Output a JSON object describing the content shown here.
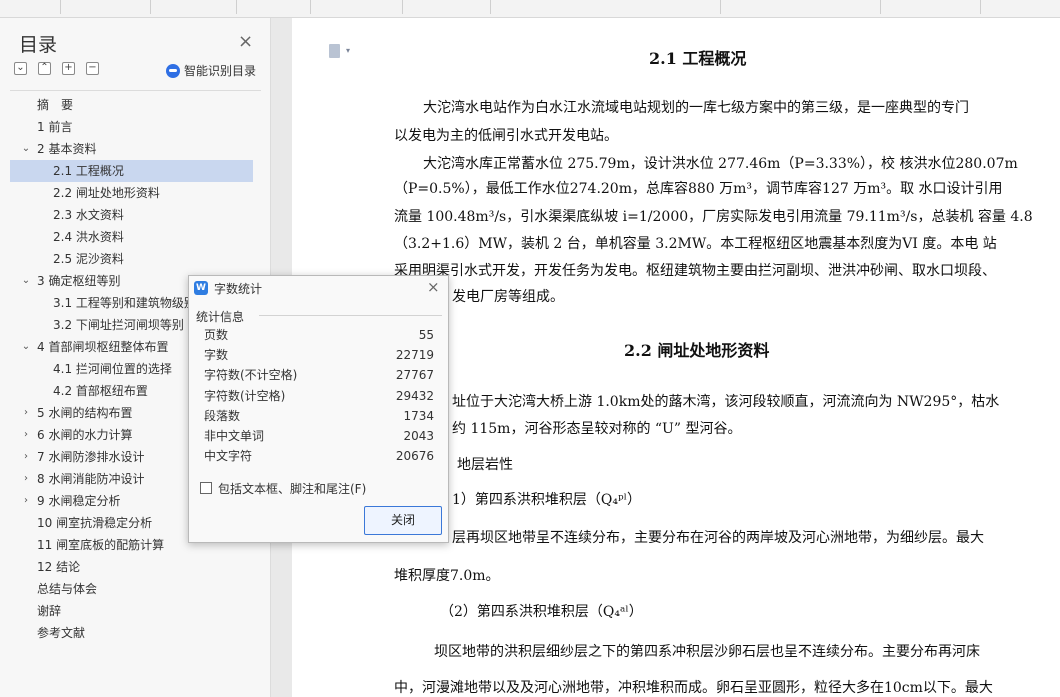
{
  "nav": {
    "title": "目录",
    "smart_label": "智能识别目录",
    "items": [
      {
        "label": "摘　要",
        "level": 1,
        "arrow": ""
      },
      {
        "label": "1 前言",
        "level": 1,
        "arrow": ""
      },
      {
        "label": "2 基本资料",
        "level": 1,
        "arrow": "expanded"
      },
      {
        "label": "2.1 工程概况",
        "level": 2,
        "arrow": "",
        "active": true
      },
      {
        "label": "2.2 闸址处地形资料",
        "level": 2,
        "arrow": ""
      },
      {
        "label": "2.3 水文资料",
        "level": 2,
        "arrow": ""
      },
      {
        "label": "2.4 洪水资料",
        "level": 2,
        "arrow": ""
      },
      {
        "label": "2.5 泥沙资料",
        "level": 2,
        "arrow": ""
      },
      {
        "label": "3  确定枢纽等别",
        "level": 1,
        "arrow": "expanded"
      },
      {
        "label": "3.1 工程等别和建筑物级别",
        "level": 2,
        "arrow": ""
      },
      {
        "label": "3.2 下闸址拦河闸坝等别",
        "level": 2,
        "arrow": ""
      },
      {
        "label": "4 首部闸坝枢纽整体布置",
        "level": 1,
        "arrow": "expanded"
      },
      {
        "label": "4.1 拦河闸位置的选择",
        "level": 2,
        "arrow": ""
      },
      {
        "label": "4.2 首部枢纽布置",
        "level": 2,
        "arrow": ""
      },
      {
        "label": "5 水闸的结构布置",
        "level": 1,
        "arrow": "collapsed"
      },
      {
        "label": "6 水闸的水力计算",
        "level": 1,
        "arrow": "collapsed"
      },
      {
        "label": "7 水闸防渗排水设计",
        "level": 1,
        "arrow": "collapsed"
      },
      {
        "label": "8 水闸消能防冲设计",
        "level": 1,
        "arrow": "collapsed"
      },
      {
        "label": "9 水闸稳定分析",
        "level": 1,
        "arrow": "collapsed"
      },
      {
        "label": "10 闸室抗滑稳定分析",
        "level": 1,
        "arrow": ""
      },
      {
        "label": "11 闸室底板的配筋计算",
        "level": 1,
        "arrow": ""
      },
      {
        "label": "12 结论",
        "level": 1,
        "arrow": ""
      },
      {
        "label": "总结与体会",
        "level": 1,
        "arrow": ""
      },
      {
        "label": "谢辞",
        "level": 1,
        "arrow": ""
      },
      {
        "label": "参考文献",
        "level": 1,
        "arrow": ""
      }
    ]
  },
  "doc": {
    "h1": "2.1 工程概况",
    "p1a": "大沱湾水电站作为白水江水流域电站规划的一库七级方案中的第三级，是一座典型的专门",
    "p1b": "以发电为主的低闸引水式开发电站。",
    "p2a": "大沱湾水库正常蓄水位 275.79m，设计洪水位 277.46m（P=3.33%），校 核洪水位280.07m",
    "p2b": "（P=0.5%），最低工作水位274.20m，总库容880 万m³，调节库容127 万m³。取 水口设计引用",
    "p2c": "流量 100.48m³/s，引水渠渠底纵坡 i=1/2000，厂房实际发电引用流量 79.11m³/s，总装机 容量 4.8",
    "p2d": "（3.2+1.6）MW，装机 2 台，单机容量 3.2MW。本工程枢纽区地震基本烈度为VI 度。本电 站",
    "p2e": "采用明渠引水式开发，开发任务为发电。枢纽建筑物主要由拦河副坝、泄洪冲砂闸、取水口坝段、",
    "p2f": "发电厂房等组成。",
    "h2": "2.2 闸址处地形资料",
    "p3a": "址位于大沱湾大桥上游 1.0km处的蕗木湾，该河段较顺直，河流流向为 NW295°，枯水",
    "p3b": "约 115m，河谷形态呈较对称的 “U” 型河谷。",
    "p4": "地层岩性",
    "p5": "1）第四系洪积堆积层（Q₄ᵖˡ）",
    "p6a": "层再坝区地带呈不连续分布，主要分布在河谷的两岸坡及河心洲地带，为细纱层。最大",
    "p6b": "堆积厚度7.0m。",
    "p7": "（2）第四系洪积堆积层（Q₄ᵃˡ）",
    "p8a": "坝区地带的洪积层细纱层之下的第四系冲积层沙卵石层也呈不连续分布。主要分布再河床",
    "p8b": "中，河漫滩地带以及及河心洲地带，冲积堆积而成。卵石呈亚圆形，粒径大多在10cm以下。最大"
  },
  "dialog": {
    "title": "字数统计",
    "section": "统计信息",
    "stats": [
      {
        "label": "页数",
        "value": "55"
      },
      {
        "label": "字数",
        "value": "22719"
      },
      {
        "label": "字符数(不计空格)",
        "value": "27767"
      },
      {
        "label": "字符数(计空格)",
        "value": "29432"
      },
      {
        "label": "段落数",
        "value": "1734"
      },
      {
        "label": "非中文单词",
        "value": "2043"
      },
      {
        "label": "中文字符",
        "value": "20676"
      }
    ],
    "checkbox_label": "包括文本框、脚注和尾注(F)",
    "close_label": "关闭"
  },
  "colors": {
    "accent": "#2f7de1",
    "active_row": "#c9d7ef"
  }
}
